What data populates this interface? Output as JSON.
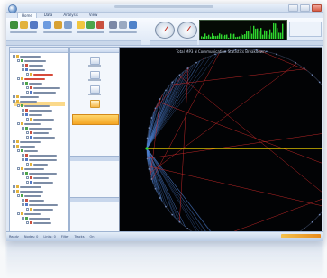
{
  "tabs": [
    {
      "label": "Home"
    },
    {
      "label": "Data"
    },
    {
      "label": "Analysis"
    },
    {
      "label": "View"
    }
  ],
  "viz": {
    "title": "Total MP3 N Communication Statistics Breakdown"
  },
  "statusbar": {
    "items": [
      "Ready",
      "Nodes: 0",
      "Links: 0",
      "Filter",
      "Tracks",
      "On"
    ]
  },
  "colors": {
    "accent": "#f5a623",
    "chord_blue": "#4d7fd0",
    "chord_red": "#d22a2a",
    "axis_line": "#ffe000",
    "graph_green": "#2fd62f"
  }
}
